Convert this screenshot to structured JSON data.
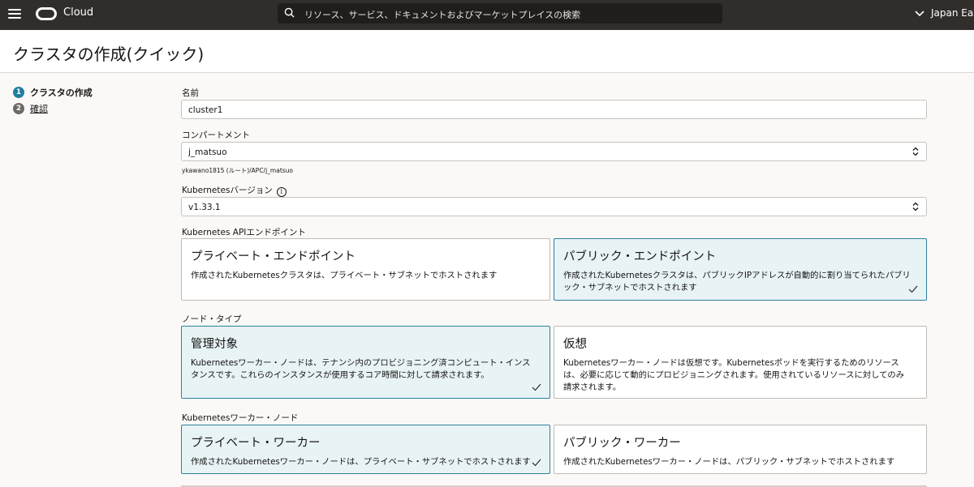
{
  "header": {
    "brand": "Cloud",
    "search_placeholder": "リソース、サービス、ドキュメントおよびマーケットプレイスの検索",
    "region": "Japan Eas"
  },
  "page": {
    "title": "クラスタの作成(クイック)"
  },
  "steps": [
    {
      "num": "1",
      "label": "クラスタの作成"
    },
    {
      "num": "2",
      "label": "確認"
    }
  ],
  "form": {
    "name": {
      "label": "名前",
      "value": "cluster1"
    },
    "compartment": {
      "label": "コンパートメント",
      "value": "j_matsuo",
      "hint": "ykawano1815 (ルート)/APC/j_matsuo"
    },
    "k8s_version": {
      "label": "Kubernetesバージョン",
      "value": "v1.33.1"
    },
    "api_endpoint": {
      "label": "Kubernetes APIエンドポイント",
      "options": [
        {
          "title": "プライベート・エンドポイント",
          "desc": "作成されたKubernetesクラスタは、プライベート・サブネットでホストされます"
        },
        {
          "title": "パブリック・エンドポイント",
          "desc": "作成されたKubernetesクラスタは、パブリックIPアドレスが自動的に割り当てられたパブリック・サブネットでホストされます"
        }
      ]
    },
    "node_type": {
      "label": "ノード・タイプ",
      "options": [
        {
          "title": "管理対象",
          "desc": "Kubernetesワーカー・ノードは、テナンシ内のプロビジョニング済コンピュート・インスタンスです。これらのインスタンスが使用するコア時間に対して請求されます。"
        },
        {
          "title": "仮想",
          "desc": "Kubernetesワーカー・ノードは仮想です。Kubernetesポッドを実行するためのリソースは、必要に応じて動的にプロビジョニングされます。使用されているリソースに対してのみ請求されます。"
        }
      ]
    },
    "worker_nodes": {
      "label": "Kubernetesワーカー・ノード",
      "options": [
        {
          "title": "プライベート・ワーカー",
          "desc": "作成されたKubernetesワーカー・ノードは、プライベート・サブネットでホストされます"
        },
        {
          "title": "パブリック・ワーカー",
          "desc": "作成されたKubernetesワーカー・ノードは、パブリック・サブネットでホストされます"
        }
      ]
    }
  },
  "colors": {
    "header_bg": "#312d2a",
    "selected_card_bg": "#e8f3f6",
    "selected_card_border": "#2e7f9d",
    "step_active": "#227e9e"
  }
}
